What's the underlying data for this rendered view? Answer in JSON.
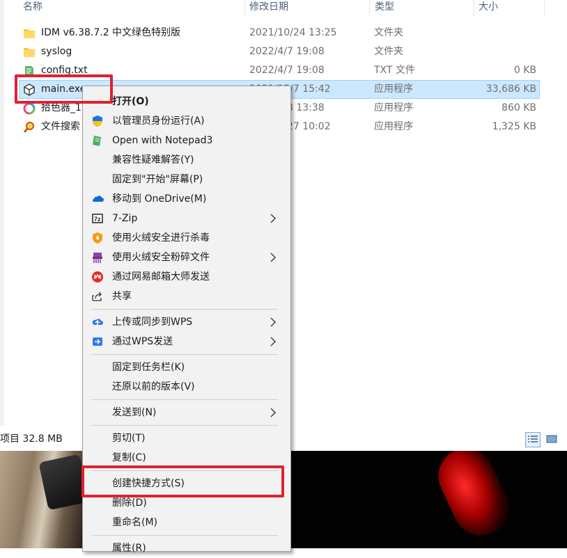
{
  "columns": {
    "name": "名称",
    "date": "修改日期",
    "type": "类型",
    "size": "大小"
  },
  "files": [
    {
      "name": "IDM v6.38.7.2  中文绿色特别版",
      "date": "2021/10/24 13:25",
      "type": "文件夹",
      "size": "",
      "icon": "folder-icon",
      "selected": false
    },
    {
      "name": "syslog",
      "date": "2022/4/7 19:08",
      "type": "文件夹",
      "size": "",
      "icon": "folder-icon",
      "selected": false
    },
    {
      "name": "config.txt",
      "date": "2022/4/7 19:08",
      "type": "TXT 文件",
      "size": "0 KB",
      "icon": "notepad-file-icon",
      "selected": false
    },
    {
      "name": "main.exe",
      "date": "2021/12/7 15:42",
      "type": "应用程序",
      "size": "33,686 KB",
      "icon": "app-cube-icon",
      "selected": true
    },
    {
      "name": "拾色器_1",
      "date": "2022/2/8 13:38",
      "type": "应用程序",
      "size": "860 KB",
      "icon": "color-wheel-icon",
      "selected": false
    },
    {
      "name": "文件搜索",
      "date": "2022/1/27 10:02",
      "type": "应用程序",
      "size": "1,325 KB",
      "icon": "search-tool-icon",
      "selected": false
    }
  ],
  "status": {
    "text": "项目 32.8 MB"
  },
  "context_menu": {
    "items": [
      {
        "label": "打开(O)",
        "icon": "",
        "bold": true
      },
      {
        "label": "以管理员身份运行(A)",
        "icon": "uac-shield-icon"
      },
      {
        "label": "Open with Notepad3",
        "icon": "notepad3-icon"
      },
      {
        "label": "兼容性疑难解答(Y)",
        "icon": ""
      },
      {
        "label": "固定到\"开始\"屏幕(P)",
        "icon": ""
      },
      {
        "label": "移动到 OneDrive(M)",
        "icon": "onedrive-icon"
      },
      {
        "label": "7-Zip",
        "icon": "7zip-icon",
        "submenu": true
      },
      {
        "label": "使用火绒安全进行杀毒",
        "icon": "huorong-antivirus-icon"
      },
      {
        "label": "使用火绒安全粉碎文件",
        "icon": "huorong-shredder-icon",
        "submenu": true
      },
      {
        "label": "通过网易邮箱大师发送",
        "icon": "netease-mail-icon"
      },
      {
        "label": "共享",
        "icon": "share-icon"
      },
      {
        "label": "上传或同步到WPS",
        "icon": "wps-upload-icon",
        "submenu": true
      },
      {
        "label": "通过WPS发送",
        "icon": "wps-send-icon",
        "submenu": true
      },
      {
        "label": "固定到任务栏(K)",
        "icon": ""
      },
      {
        "label": "还原以前的版本(V)",
        "icon": ""
      },
      {
        "label": "发送到(N)",
        "icon": "",
        "submenu": true
      },
      {
        "label": "剪切(T)",
        "icon": ""
      },
      {
        "label": "复制(C)",
        "icon": ""
      },
      {
        "label": "创建快捷方式(S)",
        "icon": ""
      },
      {
        "label": "删除(D)",
        "icon": ""
      },
      {
        "label": "重命名(M)",
        "icon": ""
      },
      {
        "label": "属性(R)",
        "icon": ""
      }
    ]
  },
  "colors": {
    "selection": "#cce8ff",
    "highlight_box": "#e0212f",
    "menu_bg": "#f2f2f2"
  }
}
